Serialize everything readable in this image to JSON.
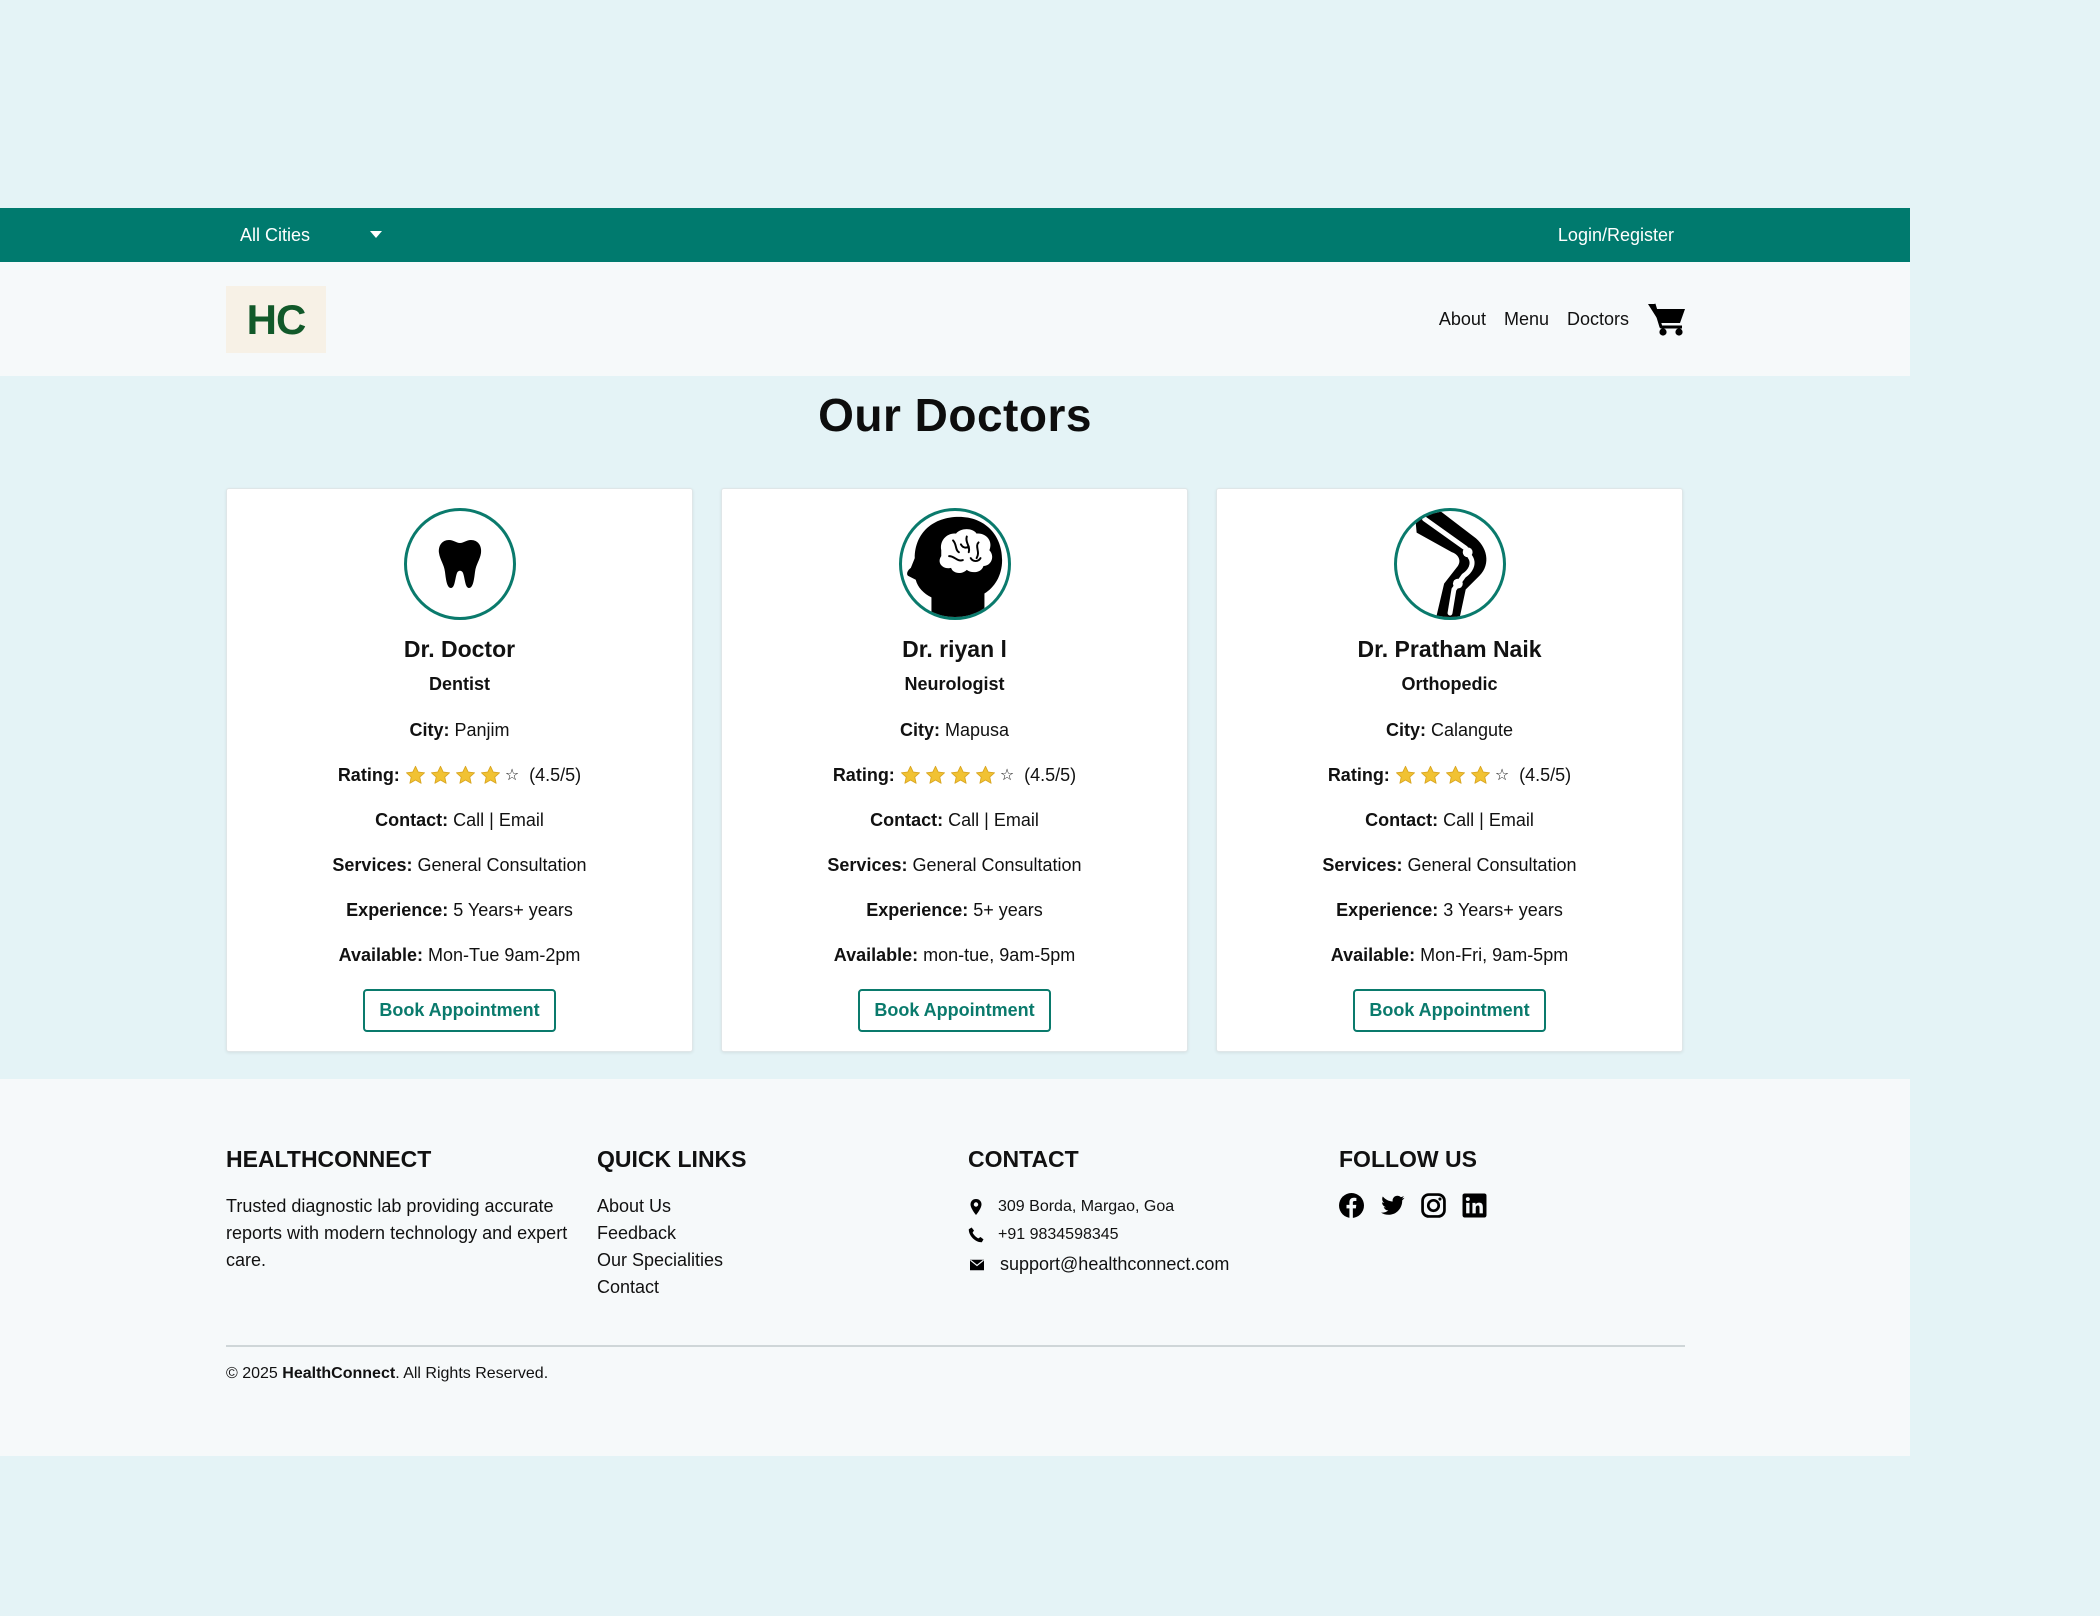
{
  "topbar": {
    "city_select": "All Cities",
    "login_label": "Login/Register"
  },
  "header": {
    "logo_text": "HC",
    "nav": [
      "About",
      "Menu",
      "Doctors"
    ],
    "cart_icon": "shopping-cart-icon"
  },
  "main": {
    "title": "Our Doctors",
    "doctors": [
      {
        "icon": "tooth-icon",
        "name": "Dr. Doctor",
        "specialty": "Dentist",
        "city_label": "City:",
        "city": "Panjim",
        "rating_label": "Rating:",
        "stars": 4,
        "rating_text": "(4.5/5)",
        "contact_label": "Contact:",
        "contact": "Call | Email",
        "services_label": "Services:",
        "services": "General Consultation",
        "experience_label": "Experience:",
        "experience": "5 Years+ years",
        "available_label": "Available:",
        "available": "Mon-Tue 9am-2pm",
        "button": "Book Appointment"
      },
      {
        "icon": "brain-head-icon",
        "name": "Dr. riyan l",
        "specialty": "Neurologist",
        "city_label": "City:",
        "city": "Mapusa",
        "rating_label": "Rating:",
        "stars": 4,
        "rating_text": "(4.5/5)",
        "contact_label": "Contact:",
        "contact": "Call | Email",
        "services_label": "Services:",
        "services": "General Consultation",
        "experience_label": "Experience:",
        "experience": "5+ years",
        "available_label": "Available:",
        "available": "mon-tue, 9am-5pm",
        "button": "Book Appointment"
      },
      {
        "icon": "knee-joint-icon",
        "name": "Dr. Pratham Naik",
        "specialty": "Orthopedic",
        "city_label": "City:",
        "city": "Calangute",
        "rating_label": "Rating:",
        "stars": 4,
        "rating_text": "(4.5/5)",
        "contact_label": "Contact:",
        "contact": "Call | Email",
        "services_label": "Services:",
        "services": "General Consultation",
        "experience_label": "Experience:",
        "experience": "3 Years+ years",
        "available_label": "Available:",
        "available": "Mon-Fri, 9am-5pm",
        "button": "Book Appointment"
      }
    ]
  },
  "footer": {
    "about": {
      "heading": "HEALTHCONNECT",
      "text": "Trusted diagnostic lab providing accurate reports with modern technology and expert care."
    },
    "links": {
      "heading": "QUICK LINKS",
      "items": [
        "About Us",
        "Feedback",
        "Our Specialities",
        "Contact"
      ]
    },
    "contact": {
      "heading": "CONTACT",
      "address": "309 Borda, Margao, Goa",
      "phone": "+91 9834598345",
      "email": "support@healthconnect.com"
    },
    "follow": {
      "heading": "FOLLOW US",
      "icons": [
        "facebook-icon",
        "twitter-icon",
        "instagram-icon",
        "linkedin-icon"
      ]
    },
    "copyright_prefix": "© 2025 ",
    "copyright_brand": "HealthConnect",
    "copyright_suffix": ". All Rights Reserved."
  },
  "colors": {
    "background": "#e4f3f6",
    "topbar": "#007a6e",
    "accent": "#0a7a6c",
    "logo_text": "#11592a",
    "star": "#f1c232"
  }
}
